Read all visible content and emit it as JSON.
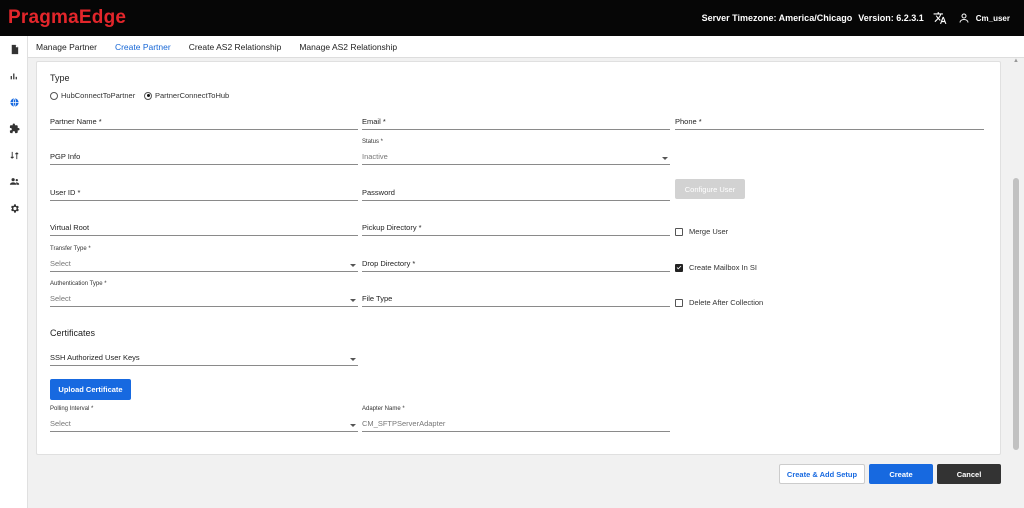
{
  "header": {
    "logo": "PragmaEdge",
    "timezone": "Server Timezone: America/Chicago",
    "version": "Version: 6.2.3.1",
    "user": "Cm_user"
  },
  "sidebar": {
    "icons": [
      "file-icon",
      "bar-chart-icon",
      "globe-icon",
      "puzzle-icon",
      "swap-icon",
      "users-icon",
      "gear-icon"
    ]
  },
  "tabs": [
    {
      "label": "Manage Partner",
      "active": false
    },
    {
      "label": "Create Partner",
      "active": true
    },
    {
      "label": "Create AS2 Relationship",
      "active": false
    },
    {
      "label": "Manage AS2 Relationship",
      "active": false
    }
  ],
  "form": {
    "type_title": "Type",
    "radio_options": [
      "HubConnectToPartner",
      "PartnerConnectToHub"
    ],
    "radio_selected": "PartnerConnectToHub",
    "partner_name": "Partner Name *",
    "email": "Email *",
    "phone": "Phone *",
    "pgp_info": "PGP Info",
    "status_label": "Status *",
    "status_value": "Inactive",
    "user_id": "User ID *",
    "password": "Password",
    "configure_user": "Configure User",
    "virtual_root": "Virtual Root",
    "pickup_directory": "Pickup Directory *",
    "merge_user": "Merge User",
    "transfer_type_label": "Transfer Type *",
    "transfer_type_value": "Select",
    "drop_directory": "Drop Directory *",
    "create_mailbox": "Create Mailbox In SI",
    "authentication_type_label": "Authentication Type *",
    "authentication_type_value": "Select",
    "file_type": "File Type",
    "delete_after_collection": "Delete After Collection",
    "certificates_title": "Certificates",
    "ssh_keys": "SSH Authorized User Keys",
    "upload_certificate": "Upload Certificate",
    "polling_interval_label": "Polling Interval *",
    "polling_interval_value": "Select",
    "adapter_name_label": "Adapter Name *",
    "adapter_name_value": "CM_SFTPServerAdapter",
    "merge_user_checked": false,
    "create_mailbox_checked": true,
    "delete_after_collection_checked": false
  },
  "actions": {
    "create_add_setup": "Create & Add Setup",
    "create": "Create",
    "cancel": "Cancel"
  },
  "colors": {
    "accent": "#1769e0",
    "brand": "#e3262b",
    "header_bg": "#060606"
  }
}
